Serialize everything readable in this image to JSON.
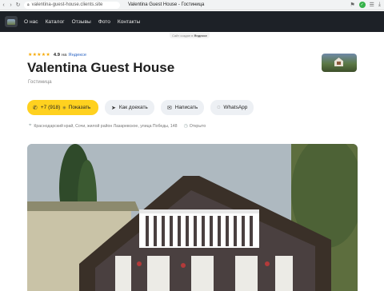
{
  "browser": {
    "url": "valentina-guest-house.clients.site",
    "page_title": "Valentina Guest House - Гостиница",
    "back_icon": "back-arrow-icon",
    "reload_icon": "reload-icon"
  },
  "nav": {
    "items": [
      "О нас",
      "Каталог",
      "Отзывы",
      "Фото",
      "Контакты"
    ]
  },
  "site_badge": {
    "prefix": "Сайт создан в",
    "brand": "Яндексе"
  },
  "business": {
    "stars": "★★★★★",
    "rating": "4.9",
    "rating_on": "на",
    "rating_source": "Яндексе",
    "name": "Valentina Guest House",
    "category": "Гостиница"
  },
  "actions": {
    "phone": "+7 (918)",
    "show_label": "Показать",
    "route_label": "Как доехать",
    "write_label": "Написать",
    "whatsapp_label": "WhatsApp"
  },
  "address": {
    "text": "Краснодарский край, Сочи, жилой район Лазаревское, улица Победы, 148",
    "status": "Открыто"
  },
  "colors": {
    "nav_bg": "#1d2127",
    "call_button": "#ffd11f",
    "star": "#f6a800",
    "link": "#2f67c4"
  }
}
